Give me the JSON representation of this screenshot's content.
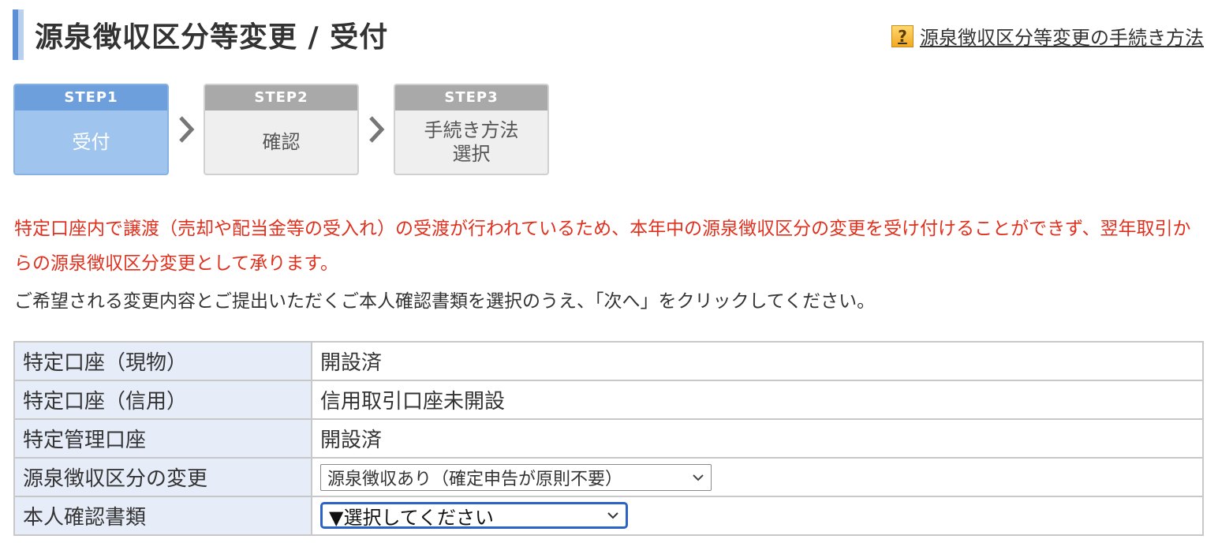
{
  "header": {
    "title": "源泉徴収区分等変更 / 受付",
    "help_icon": "question-icon",
    "help_icon_glyph": "?",
    "help_link": "源泉徴収区分等変更の手続き方法"
  },
  "steps": [
    {
      "label": "STEP1",
      "name": "受付",
      "active": true
    },
    {
      "label": "STEP2",
      "name": "確認",
      "active": false
    },
    {
      "label": "STEP3",
      "name": "手続き方法\n選択",
      "active": false
    }
  ],
  "messages": {
    "warning": "特定口座内で譲渡（売却や配当金等の受入れ）の受渡が行われているため、本年中の源泉徴収区分の変更を受け付けることができず、翌年取引からの源泉徴収区分変更として承ります。",
    "instruction": "ご希望される変更内容とご提出いただくご本人確認書類を選択のうえ、「次へ」をクリックしてください。"
  },
  "table": {
    "rows": [
      {
        "label": "特定口座（現物）",
        "value": "開設済"
      },
      {
        "label": "特定口座（信用）",
        "value": "信用取引口座未開設"
      },
      {
        "label": "特定管理口座",
        "value": "開設済"
      },
      {
        "label": "源泉徴収区分の変更",
        "select_value": "源泉徴収あり（確定申告が原則不要）"
      },
      {
        "label": "本人確認書類",
        "select_value": "▼選択してください"
      }
    ]
  },
  "colors": {
    "accent": "#6e9fdd",
    "warning_text": "#e0301e",
    "label_bg": "#e6edf8"
  }
}
